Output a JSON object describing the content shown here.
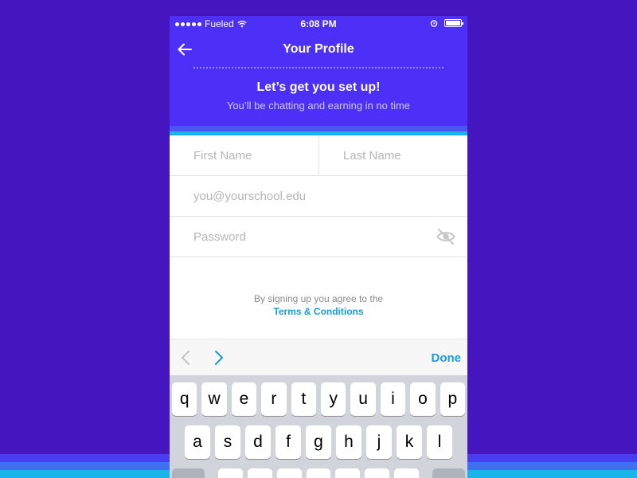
{
  "status_bar": {
    "carrier": "Fueled",
    "time": "6:08 PM"
  },
  "nav": {
    "title": "Your Profile"
  },
  "intro": {
    "title": "Let’s get you set up!",
    "subtitle": "You’ll be chatting and earning in no time"
  },
  "form": {
    "first_name_placeholder": "First Name",
    "last_name_placeholder": "Last Name",
    "email_placeholder": "you@yourschool.edu",
    "password_placeholder": "Password"
  },
  "terms": {
    "text": "By signing up you agree to the",
    "link": "Terms & Conditions"
  },
  "keyboard_toolbar": {
    "done_label": "Done"
  },
  "keyboard": {
    "row1": [
      "q",
      "w",
      "e",
      "r",
      "t",
      "y",
      "u",
      "i",
      "o",
      "p"
    ],
    "row2": [
      "a",
      "s",
      "d",
      "f",
      "g",
      "h",
      "j",
      "k",
      "l"
    ],
    "row3": [
      "",
      "",
      "",
      "",
      "",
      "",
      "",
      "",
      ""
    ]
  },
  "colors": {
    "background": "#4516bf",
    "header": "#4c30f7",
    "accent_cyan": "#1ab4ea",
    "link_blue": "#1a9bd9"
  }
}
